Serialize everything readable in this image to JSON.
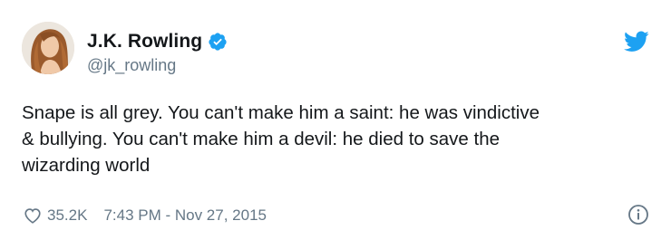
{
  "tweet": {
    "display_name": "J.K. Rowling",
    "handle": "@jk_rowling",
    "verified": true,
    "text": "Snape is all grey. You can't make him a saint: he was vindictive\n& bullying. You can't make him a devil: he died to save the\nwizarding world",
    "like_count": "35.2K",
    "timestamp": "7:43 PM - Nov 27, 2015"
  },
  "icons": {
    "verified": "verified-badge-icon",
    "brand": "twitter-bird-icon",
    "like": "heart-icon",
    "info": "info-icon"
  },
  "colors": {
    "brand_blue": "#1da1f2",
    "text_primary": "#14171a",
    "text_secondary": "#657786"
  }
}
